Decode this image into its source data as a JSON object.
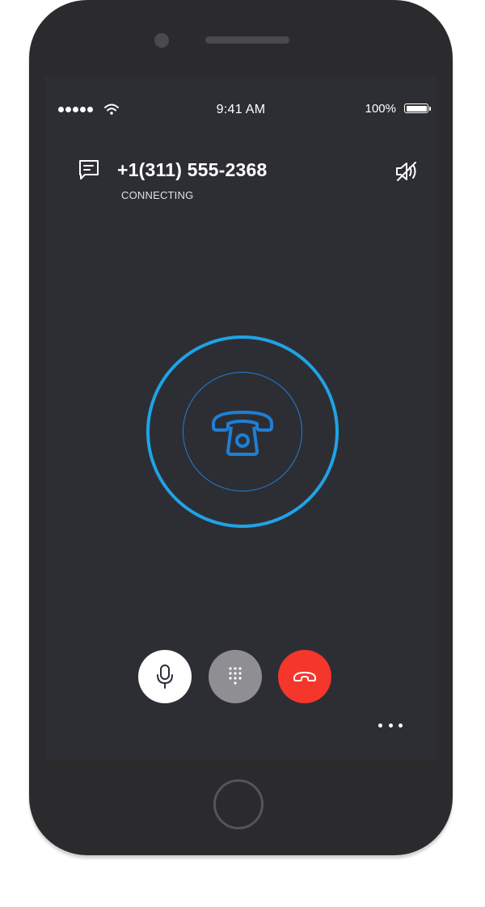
{
  "status_bar": {
    "time": "9:41 AM",
    "battery_percent": "100%",
    "signal_bars": 5,
    "wifi_icon": "wifi-icon"
  },
  "call": {
    "number": "+1(311) 555-2368",
    "status": "CONNECTING",
    "message_icon": "message-icon",
    "speaker_mute_icon": "speaker-mute-icon",
    "center_icon": "phone-handset-icon"
  },
  "controls": {
    "mic": {
      "icon": "microphone-icon",
      "color": "#ffffff"
    },
    "keypad": {
      "icon": "keypad-icon",
      "color": "#8e8e93"
    },
    "end_call": {
      "icon": "hang-up-icon",
      "color": "#f4362b"
    },
    "more": {
      "icon": "more-icon"
    }
  },
  "colors": {
    "ring_accent": "#1fa3e6",
    "screen_background": "#2d2e34",
    "phone_body": "#2b2b2d"
  }
}
